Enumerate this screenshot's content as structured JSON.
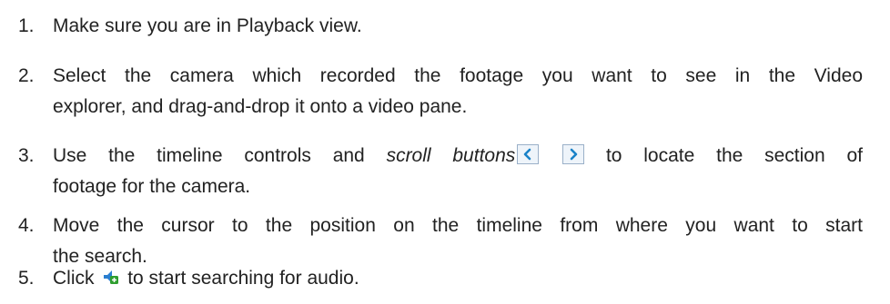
{
  "steps": [
    {
      "number": "1.",
      "text": "Make sure you are in Playback view."
    },
    {
      "number": "2.",
      "line1": "Select the camera which recorded the footage you want to see in the Video",
      "line2": "explorer, and drag-and-drop it onto a video pane."
    },
    {
      "number": "3.",
      "before": "Use the timeline controls and",
      "em": "scroll buttons",
      "after": "to locate the section of",
      "line2": "footage for the camera."
    },
    {
      "number": "4.",
      "line1": "Move the cursor to the position on the timeline from where you want to start",
      "line2": "the search."
    },
    {
      "number": "5.",
      "before": "Click",
      "after": "to start searching for audio."
    }
  ],
  "icons": {
    "scroll_left": "chevron-left-icon",
    "scroll_right": "chevron-right-icon",
    "audio_search": "audio-search-icon"
  },
  "colors": {
    "text": "#222222",
    "chevron": "#1a82c8",
    "audio_green": "#2e9e2e",
    "audio_blue": "#2a7fd0"
  }
}
